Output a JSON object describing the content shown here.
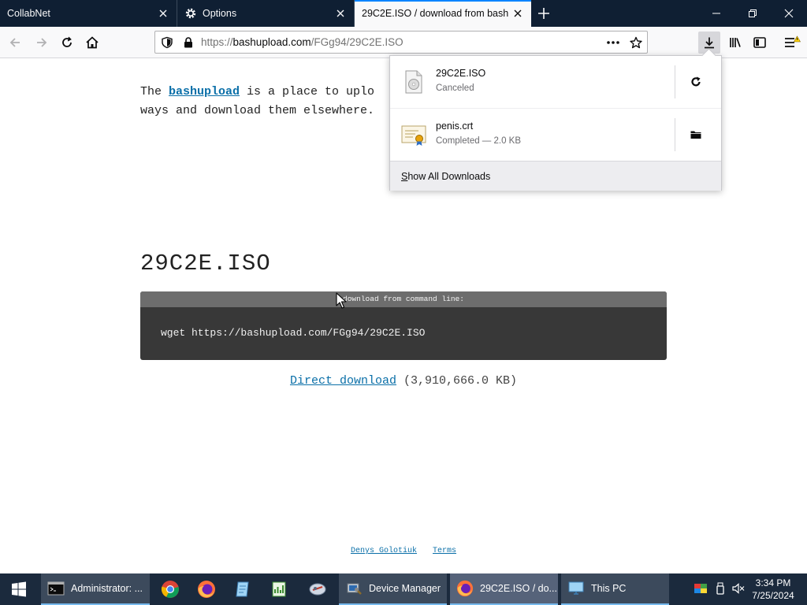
{
  "tabs": [
    {
      "title": "CollabNet"
    },
    {
      "title": "Options"
    },
    {
      "title": "29C2E.ISO / download from bashup"
    }
  ],
  "url": {
    "prefix": "https://",
    "host": "bashupload.com",
    "path": "/FGg94/29C2E.ISO"
  },
  "page": {
    "intro_the": "The ",
    "intro_link": "bashupload",
    "intro_rest1": " is a place to uplo",
    "intro_rest2": "ways and download them elsewhere.",
    "file_title": "29C2E.ISO",
    "cmd_header": "download from command line:",
    "cmd": "wget https://bashupload.com/FGg94/29C2E.ISO",
    "direct_link": "Direct download",
    "size": " (3,910,666.0 KB)",
    "footer_author": "Denys Golotiuk",
    "footer_terms": "Terms"
  },
  "downloads": {
    "items": [
      {
        "name": "29C2E.ISO",
        "status": "Canceled",
        "action_icon": "retry-icon"
      },
      {
        "name": "penis.crt",
        "status": "Completed — 2.0 KB",
        "action_icon": "folder-icon"
      }
    ],
    "show_all": "Show All Downloads"
  },
  "taskbar": {
    "apps": [
      {
        "label": "Administrator: ..."
      },
      {
        "label": "Device Manager"
      },
      {
        "label": "29C2E.ISO / do..."
      },
      {
        "label": "This PC"
      }
    ],
    "time": "3:34 PM",
    "date": "7/25/2024"
  },
  "colors": {
    "accent": "#0a84ff",
    "link": "#0a6fa8",
    "tabstrip": "#0f1f33",
    "taskbar": "#1b2a3d"
  }
}
